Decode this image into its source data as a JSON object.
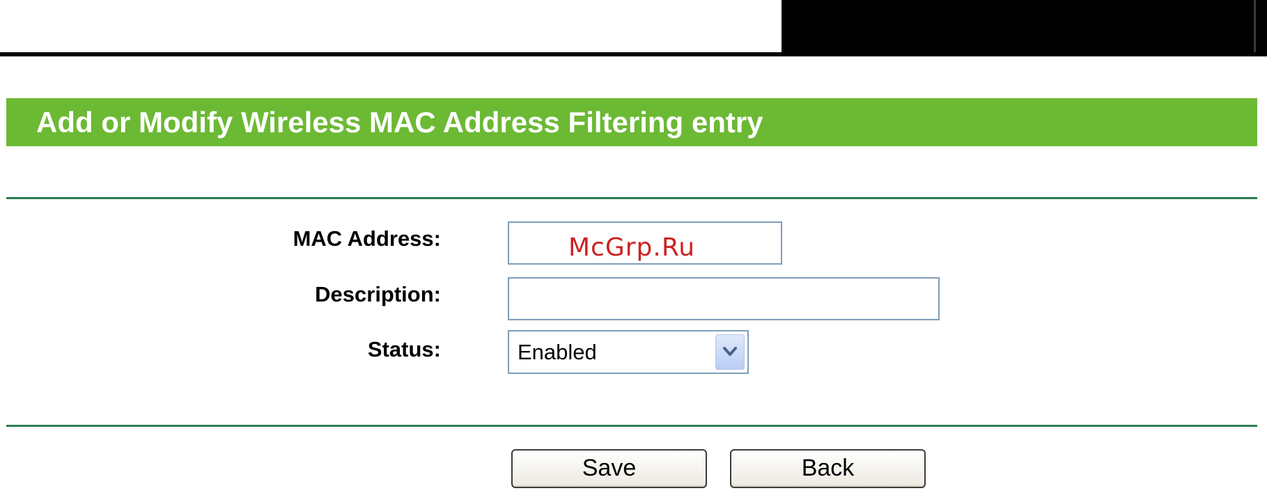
{
  "header": {
    "title": "Add or Modify Wireless MAC Address Filtering entry"
  },
  "form": {
    "mac_label": "MAC Address:",
    "mac_value": "",
    "description_label": "Description:",
    "description_value": "",
    "status_label": "Status:",
    "status_value": "Enabled"
  },
  "buttons": {
    "save_label": "Save",
    "back_label": "Back"
  },
  "watermark": "McGrp.Ru",
  "colors": {
    "title_bar": "#6cb934",
    "divider": "#2e7d52",
    "input_border": "#7f9db9",
    "watermark": "#cc2222"
  }
}
